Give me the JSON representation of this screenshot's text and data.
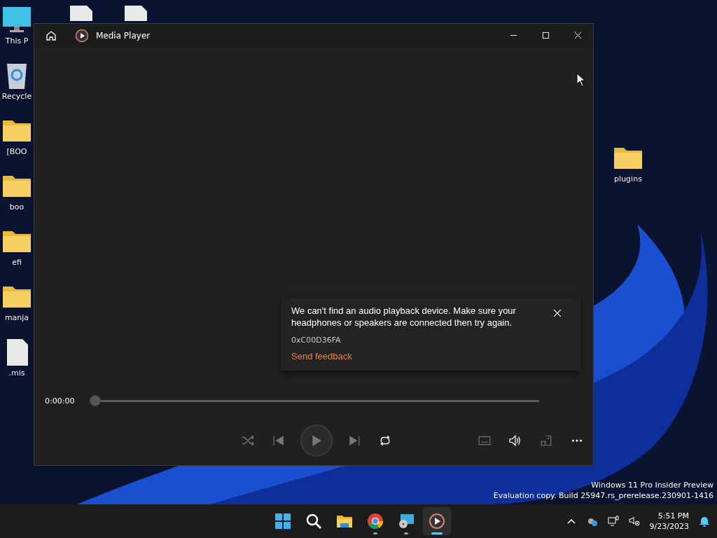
{
  "desktop": {
    "icons": [
      {
        "kind": "pc",
        "label": "This P"
      },
      {
        "kind": "recycle",
        "label": "Recycle"
      },
      {
        "kind": "folder",
        "label": "[BOO"
      },
      {
        "kind": "folder",
        "label": "boo"
      },
      {
        "kind": "folder",
        "label": "efi"
      },
      {
        "kind": "folder",
        "label": "manja"
      },
      {
        "kind": "file",
        "label": ".mis"
      }
    ],
    "top_icons": [
      {
        "kind": "file"
      },
      {
        "kind": "file"
      }
    ],
    "right_icons": [
      {
        "kind": "folder",
        "label": "plugins"
      }
    ],
    "watermark": [
      "Windows 11 Pro Insider Preview",
      "Evaluation copy. Build 25947.rs_prerelease.230901-1416"
    ]
  },
  "window": {
    "title": "Media Player",
    "toast": {
      "message": "We can't find an audio playback device. Make sure your headphones or speakers are connected then try again.",
      "code": "0xC00D36FA",
      "link": "Send feedback"
    },
    "seek": {
      "time": "0:00:00",
      "level": 0
    },
    "controls": [
      {
        "kind": "shuffle",
        "disabled": true
      },
      {
        "kind": "previous",
        "disabled": true
      },
      {
        "kind": "play",
        "disabled": true
      },
      {
        "kind": "next",
        "disabled": true
      },
      {
        "kind": "repeat",
        "disabled": false
      }
    ],
    "right_controls": [
      {
        "kind": "subtitles",
        "disabled": true
      },
      {
        "kind": "volume",
        "disabled": false
      },
      {
        "kind": "miniview",
        "disabled": true
      },
      {
        "kind": "more",
        "disabled": false
      }
    ]
  },
  "taskbar": {
    "apps": [
      {
        "kind": "start",
        "running": false,
        "selected": false
      },
      {
        "kind": "search",
        "running": false,
        "selected": false
      },
      {
        "kind": "explorer",
        "running": false,
        "selected": false
      },
      {
        "kind": "chrome",
        "running": true,
        "selected": false
      },
      {
        "kind": "disc",
        "running": true,
        "selected": false
      },
      {
        "kind": "player",
        "running": true,
        "selected": true
      }
    ],
    "time": "5:51 PM",
    "date": "9/23/2023"
  }
}
